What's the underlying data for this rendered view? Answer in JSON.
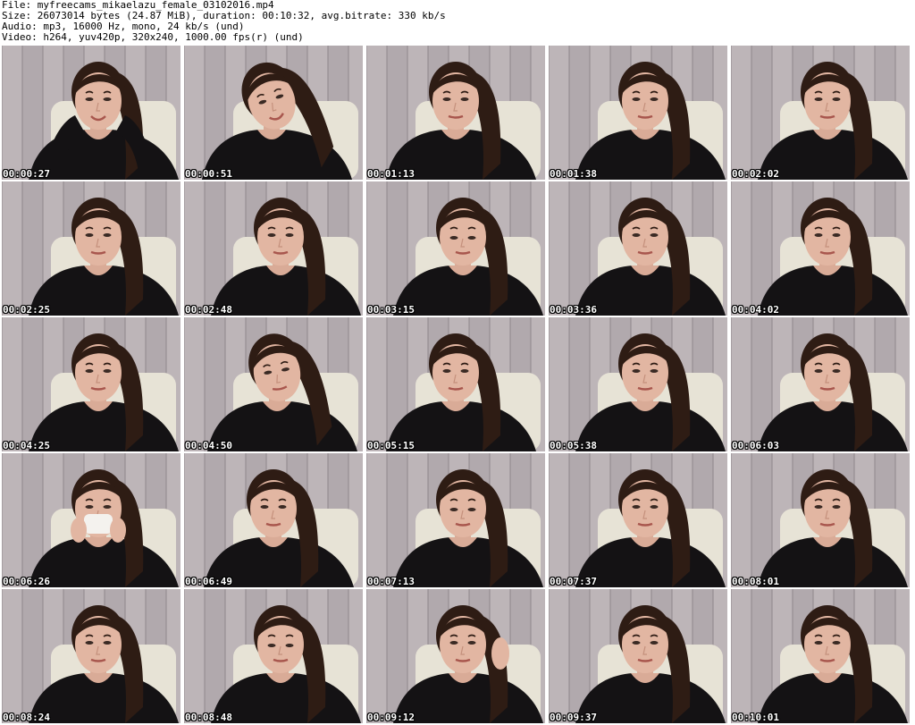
{
  "header": {
    "file": "File: myfreecams_mikaelazu_female_03102016.mp4",
    "size": "Size: 26073014 bytes (24.87 MiB), duration: 00:10:32, avg.bitrate: 330 kb/s",
    "audio": "Audio: mp3, 16000 Hz, mono, 24 kb/s (und)",
    "video": "Video: h264, yuv420p, 320x240, 1000.00 fps(r) (und)"
  },
  "frames": [
    {
      "timestamp": "00:00:27",
      "scene": "arms-raised"
    },
    {
      "timestamp": "00:00:51",
      "scene": "head-tilted-smile"
    },
    {
      "timestamp": "00:01:13",
      "scene": "looking-left"
    },
    {
      "timestamp": "00:01:38",
      "scene": "front-facing"
    },
    {
      "timestamp": "00:02:02",
      "scene": "front-facing"
    },
    {
      "timestamp": "00:02:25",
      "scene": "front-facing"
    },
    {
      "timestamp": "00:02:48",
      "scene": "front-facing"
    },
    {
      "timestamp": "00:03:15",
      "scene": "looking-down"
    },
    {
      "timestamp": "00:03:36",
      "scene": "front-facing"
    },
    {
      "timestamp": "00:04:02",
      "scene": "front-facing"
    },
    {
      "timestamp": "00:04:25",
      "scene": "front-facing"
    },
    {
      "timestamp": "00:04:50",
      "scene": "head-tilted"
    },
    {
      "timestamp": "00:05:15",
      "scene": "looking-left"
    },
    {
      "timestamp": "00:05:38",
      "scene": "front-facing"
    },
    {
      "timestamp": "00:06:03",
      "scene": "front-facing"
    },
    {
      "timestamp": "00:06:26",
      "scene": "tissue-to-face"
    },
    {
      "timestamp": "00:06:49",
      "scene": "looking-left"
    },
    {
      "timestamp": "00:07:13",
      "scene": "looking-down"
    },
    {
      "timestamp": "00:07:37",
      "scene": "front-facing"
    },
    {
      "timestamp": "00:08:01",
      "scene": "front-facing"
    },
    {
      "timestamp": "00:08:24",
      "scene": "front-facing"
    },
    {
      "timestamp": "00:08:48",
      "scene": "looking-down"
    },
    {
      "timestamp": "00:09:12",
      "scene": "hand-to-hair"
    },
    {
      "timestamp": "00:09:37",
      "scene": "front-facing"
    },
    {
      "timestamp": "00:10:01",
      "scene": "front-facing"
    }
  ]
}
